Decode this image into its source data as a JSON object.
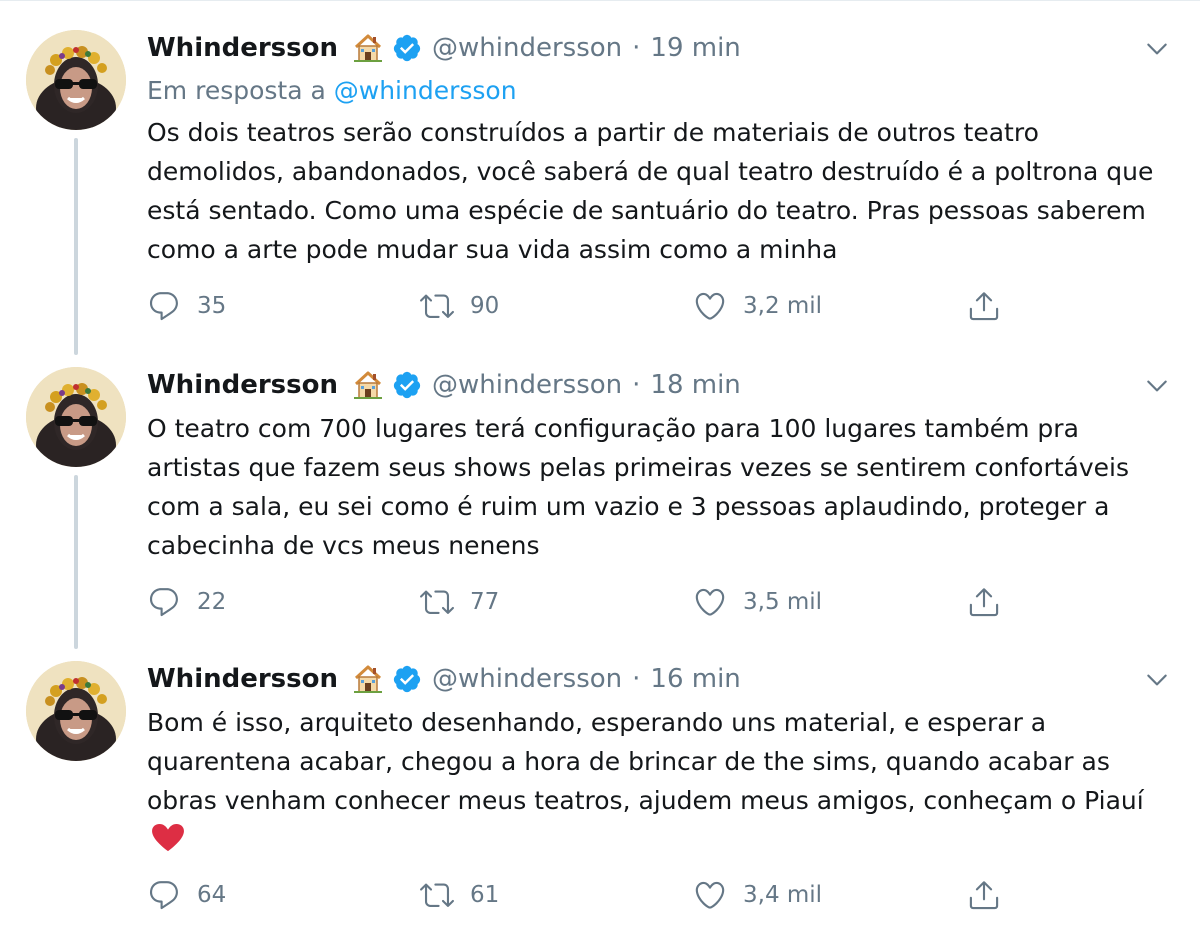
{
  "tweets": [
    {
      "name": "Whindersson",
      "handle": "@whindersson",
      "separator": "·",
      "time": "19 min",
      "reply_prefix": "Em resposta a",
      "reply_mention": "@whindersson",
      "text": "Os dois teatros serão construídos a partir de materiais de outros teatro demolidos, abandonados, você saberá de qual teatro destruído é a poltrona que está sentado. Como uma espécie de santuário do teatro. Pras pessoas saberem como a arte pode mudar sua vida assim como a minha",
      "replies": "35",
      "retweets": "90",
      "likes": "3,2 mil"
    },
    {
      "name": "Whindersson",
      "handle": "@whindersson",
      "separator": "·",
      "time": "18 min",
      "text": "O teatro com 700 lugares terá configuração para 100 lugares também pra artistas que fazem seus shows pelas primeiras vezes se sentirem confortáveis com a sala, eu sei como é ruim um vazio e 3 pessoas aplaudindo, proteger a cabecinha de vcs meus nenens",
      "replies": "22",
      "retweets": "77",
      "likes": "3,5 mil"
    },
    {
      "name": "Whindersson",
      "handle": "@whindersson",
      "separator": "·",
      "time": "16 min",
      "text": "Bom é isso, arquiteto desenhando, esperando uns material, e esperar a quarentena acabar, chegou a hora de brincar de the sims, quando acabar as obras venham conhecer meus teatros, ajudem meus amigos, conheçam o Piauí",
      "replies": "64",
      "retweets": "61",
      "likes": "3,4 mil"
    }
  ],
  "colors": {
    "text": "#14171a",
    "secondary": "#657786",
    "link": "#1da1f2",
    "thread_line": "#ccd6dd",
    "verified": "#1da1f2",
    "heart_emoji": "#dd2e44"
  },
  "icons": {
    "house": "house-emoji-icon",
    "verified": "verified-badge-icon",
    "chevron": "chevron-down-icon",
    "reply": "reply-icon",
    "retweet": "retweet-icon",
    "like": "heart-icon",
    "share": "share-icon",
    "heart_emoji": "red-heart-emoji-icon"
  }
}
